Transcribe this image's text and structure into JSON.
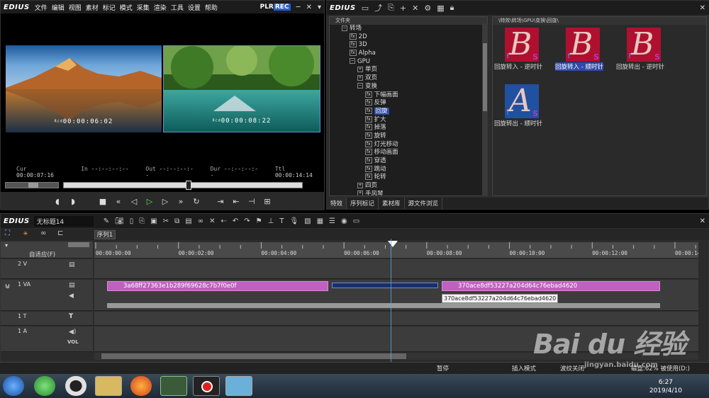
{
  "player": {
    "app_logo": "EDIUS",
    "menu": [
      "文件",
      "编辑",
      "视图",
      "素材",
      "标记",
      "模式",
      "采集",
      "渲染",
      "工具",
      "设置",
      "帮助"
    ],
    "plr": "PLR",
    "rec": "REC",
    "src_timecode": "00:00:06:02",
    "rec_timecode": "00:00:08:22",
    "tc_small_label": "Rcd",
    "cur_label": "Cur",
    "cur_value": "00:00:07:16",
    "in_label": "In",
    "in_value": "--:--:--:--",
    "out_label": "Out",
    "out_value": "--:--:--:--",
    "dur_label": "Dur",
    "dur_value": "--:--:--:--",
    "ttl_label": "Ttl",
    "ttl_value": "00:00:14:14",
    "scrub_progress": 0.52
  },
  "bin": {
    "app_logo": "EDIUS",
    "folder_header": "文件夹",
    "path": "\\特效\\转场\\GPU\\变换\\回旋\\",
    "tree": [
      {
        "label": "转场",
        "indent": 1,
        "kind": "exp",
        "symbol": "−"
      },
      {
        "label": "2D",
        "indent": 2,
        "kind": "fx"
      },
      {
        "label": "3D",
        "indent": 2,
        "kind": "fx"
      },
      {
        "label": "Alpha",
        "indent": 2,
        "kind": "fx"
      },
      {
        "label": "GPU",
        "indent": 2,
        "kind": "exp",
        "symbol": "−"
      },
      {
        "label": "单页",
        "indent": 3,
        "kind": "exp",
        "symbol": "+"
      },
      {
        "label": "双页",
        "indent": 3,
        "kind": "exp",
        "symbol": "+"
      },
      {
        "label": "变换",
        "indent": 3,
        "kind": "exp",
        "symbol": "−"
      },
      {
        "label": "下幅画面",
        "indent": 4,
        "kind": "fx"
      },
      {
        "label": "反弹",
        "indent": 4,
        "kind": "fx"
      },
      {
        "label": "回旋",
        "indent": 4,
        "kind": "fx",
        "selected": true
      },
      {
        "label": "扩大",
        "indent": 4,
        "kind": "fx"
      },
      {
        "label": "掉落",
        "indent": 4,
        "kind": "fx"
      },
      {
        "label": "旋转",
        "indent": 4,
        "kind": "fx"
      },
      {
        "label": "灯光移动",
        "indent": 4,
        "kind": "fx"
      },
      {
        "label": "移动画面",
        "indent": 4,
        "kind": "fx"
      },
      {
        "label": "穿透",
        "indent": 4,
        "kind": "fx"
      },
      {
        "label": "跳动",
        "indent": 4,
        "kind": "fx"
      },
      {
        "label": "轮转",
        "indent": 4,
        "kind": "fx"
      },
      {
        "label": "四页",
        "indent": 3,
        "kind": "exp",
        "symbol": "+"
      },
      {
        "label": "手风琴",
        "indent": 3,
        "kind": "exp",
        "symbol": "+"
      }
    ],
    "effects": [
      {
        "label": "回旋转入 - 逆时针",
        "letter": "B",
        "bg": "#b01030"
      },
      {
        "label": "回旋转入 - 顺时针",
        "letter": "B",
        "bg": "#b01030",
        "selected": true
      },
      {
        "label": "回旋转出 - 逆时针",
        "letter": "B",
        "bg": "#b01030"
      },
      {
        "label": "回旋转出 - 顺时针",
        "letter": "A",
        "bg": "#2050a0"
      }
    ],
    "tabs": [
      "特效",
      "序列标记",
      "素材库",
      "源文件浏览"
    ]
  },
  "timeline": {
    "app_logo": "EDIUS",
    "project_name": "无标题14",
    "sequence_tab": "序列1",
    "adapt_label": "自适应(F)",
    "ruler": [
      "00:00:00:00",
      "00:00:02:00",
      "00:00:04:00",
      "00:00:06:00",
      "00:00:08:00",
      "00:00:10:00",
      "00:00:12:00",
      "00:00:14:00"
    ],
    "tracks": {
      "v2": "2 V",
      "va1": "1 VA",
      "t1": "1 T",
      "a1": "1 A",
      "vol": "VOL"
    },
    "clip1": "3a68ff27363e1b289f69628c7b7f0e0f",
    "clip2": "370ace8df53227a204d64c76ebad4620",
    "tooltip": "370ace8df53227a204d64c76ebad4620",
    "status": {
      "pause": "暂停",
      "insert": "插入模式",
      "ripple": "波纹关闭",
      "disk": "磁盘:62% 被使用(D:)"
    }
  },
  "taskbar": {
    "time": "6:27",
    "date": "2019/4/10"
  },
  "watermark": {
    "main": "Bai du 经验",
    "sub": "jingyan.baidu.com"
  }
}
